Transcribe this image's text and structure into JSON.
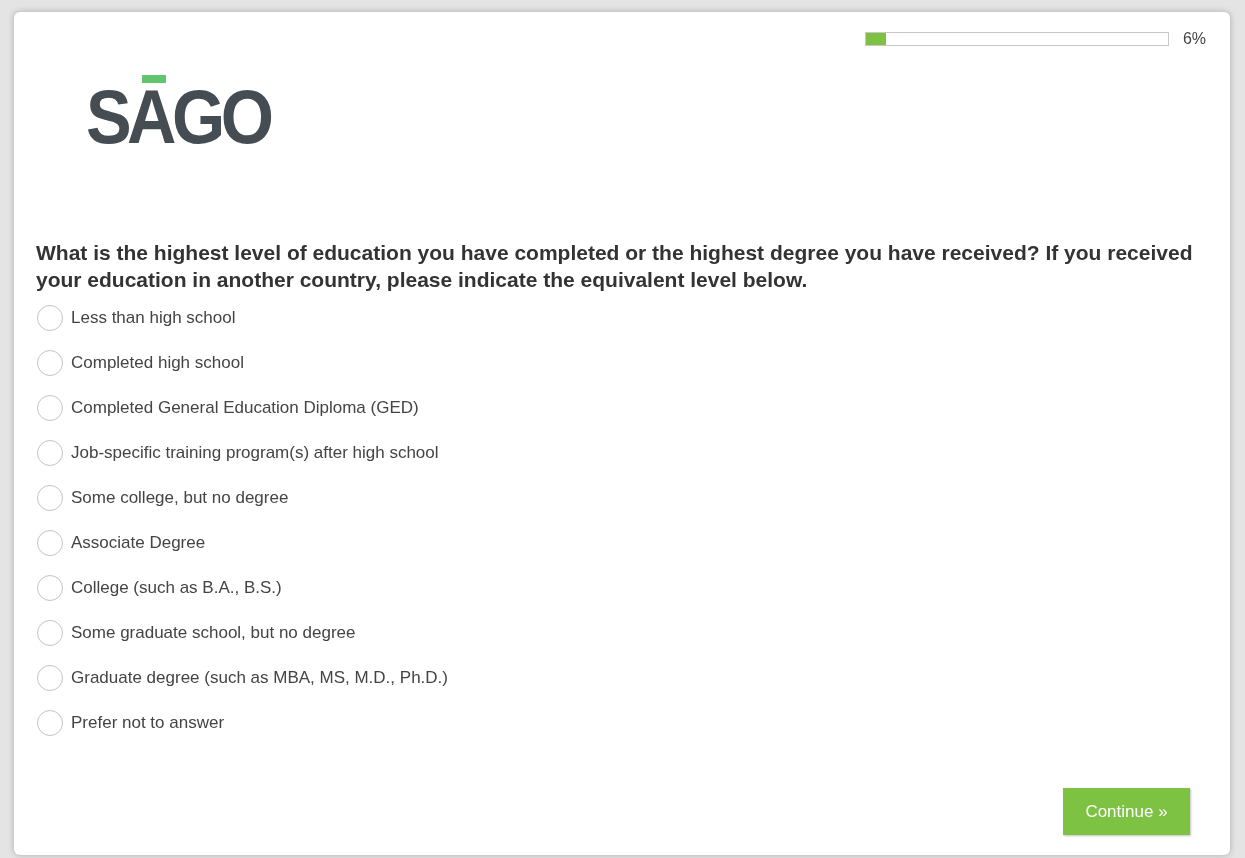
{
  "progress": {
    "level": 0.065,
    "reading": "6%"
  },
  "logo": "SAGO",
  "question": "What is the highest level of education you have completed or the highest degree you have received? If you received your education in another country, please indicate the equivalent level below.",
  "options": [
    {
      "label": "Less than high school",
      "selected": false
    },
    {
      "label": "Completed high school",
      "selected": false
    },
    {
      "label": "Completed General Education Diploma (GED)",
      "selected": false
    },
    {
      "label": "Job-specific training program(s) after high school",
      "selected": false
    },
    {
      "label": "Some college, but no degree",
      "selected": false
    },
    {
      "label": "Associate Degree",
      "selected": false
    },
    {
      "label": "College (such as B.A., B.S.)",
      "selected": false
    },
    {
      "label": "Some graduate school, but no degree",
      "selected": false
    },
    {
      "label": "Graduate degree (such as MBA, MS, M.D., Ph.D.)",
      "selected": false
    },
    {
      "label": "Prefer not to answer",
      "selected": false
    }
  ],
  "continue_button": "Continue »"
}
